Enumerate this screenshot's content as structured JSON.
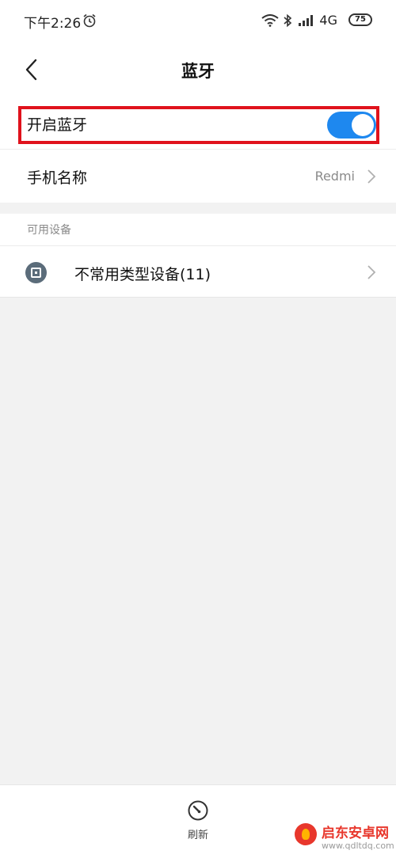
{
  "status_bar": {
    "time": "下午2:26",
    "network": "4G",
    "battery": "75"
  },
  "header": {
    "title": "蓝牙"
  },
  "bluetooth_toggle": {
    "label": "开启蓝牙",
    "enabled": true,
    "accent_color": "#1e88ef",
    "highlight_color": "#e0121c"
  },
  "device_name": {
    "label": "手机名称",
    "value": "Redmi"
  },
  "available_devices": {
    "section_title": "可用设备",
    "items": [
      {
        "label": "不常用类型设备(11)",
        "icon": "device-icon"
      }
    ]
  },
  "bottom_bar": {
    "refresh_label": "刷新"
  },
  "watermark": {
    "title": "启东安卓网",
    "url": "www.qdltdq.com"
  }
}
